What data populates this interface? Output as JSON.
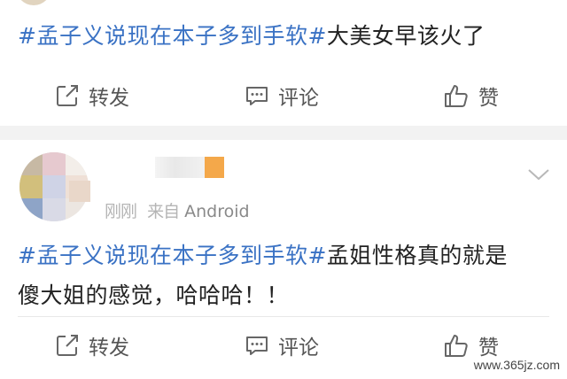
{
  "posts": [
    {
      "tag": "#孟子义说现在本子多到手软#",
      "text": "大美女早该火了",
      "actions": {
        "repost": "转发",
        "comment": "评论",
        "like": "赞"
      }
    },
    {
      "time": "刚刚",
      "source_prefix": "来自",
      "source": "Android",
      "tag": "#孟子义说现在本子多到手软#",
      "text_line1": "孟姐性格真的就是",
      "text_line2": "傻大姐的感觉，哈哈哈！！",
      "actions": {
        "repost": "转发",
        "comment": "评论",
        "like": "赞"
      }
    }
  ],
  "watermark": "www.365jz.com",
  "colors": {
    "topic": "#3a72c4",
    "text": "#222222",
    "muted": "#8a8a8a",
    "divider": "#f2f2f2"
  }
}
